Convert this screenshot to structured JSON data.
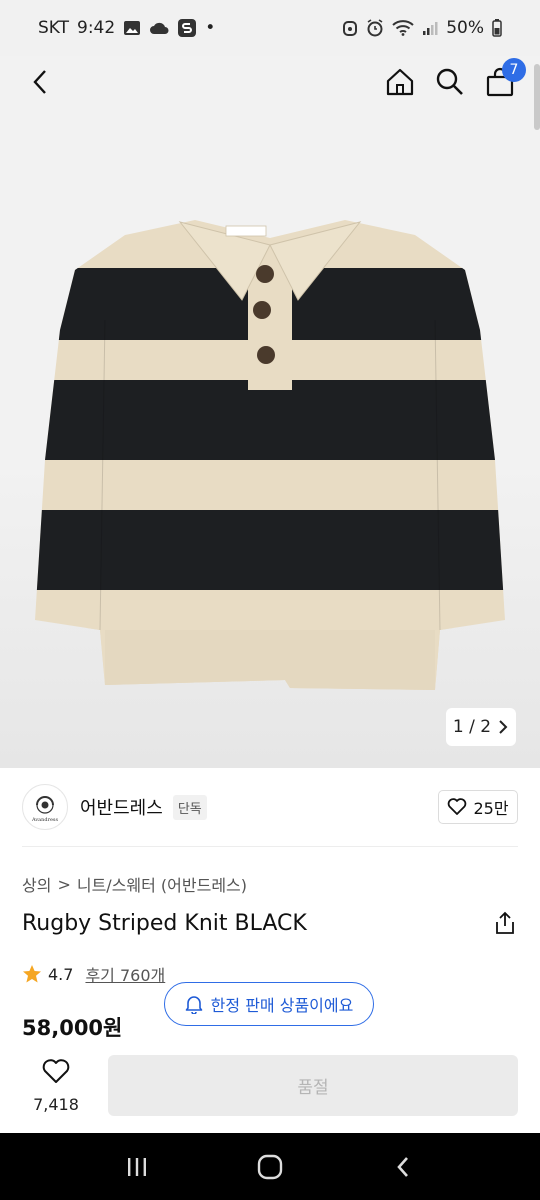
{
  "status_bar": {
    "carrier": "SKT",
    "time": "9:42",
    "battery": "50%",
    "dot": "•",
    "icons_left": [
      "image-icon",
      "cloud-icon",
      "s-app-icon"
    ],
    "icons_right": [
      "alarm-icon",
      "clock-icon",
      "wifi-icon",
      "signal-icon",
      "battery-icon"
    ]
  },
  "nav": {
    "cart_count": "7",
    "icons": [
      "back-icon",
      "home-icon",
      "search-icon",
      "cart-icon"
    ]
  },
  "gallery": {
    "pager": "1 / 2",
    "sweater_colors": {
      "cream": "#e8dcc4",
      "stripe": "#1d1f22"
    }
  },
  "brand": {
    "name": "어반드레스",
    "tag": "단독",
    "likes": "25만",
    "logo_text": "Avandress"
  },
  "breadcrumb": {
    "first": "상의",
    "separator": ">",
    "second": "니트/스웨터 (어반드레스)"
  },
  "product": {
    "title": "Rugby Striped Knit BLACK",
    "rating": "4.7",
    "reviews": "후기 760개",
    "price": "58,000원",
    "limited_notice": "한정 판매 상품이에요"
  },
  "action_bar": {
    "wish_count": "7,418",
    "soldout_label": "품절"
  },
  "colors": {
    "accent_blue": "#2f6de6",
    "star": "#f5a623",
    "soldout_bg": "#ebebeb"
  }
}
